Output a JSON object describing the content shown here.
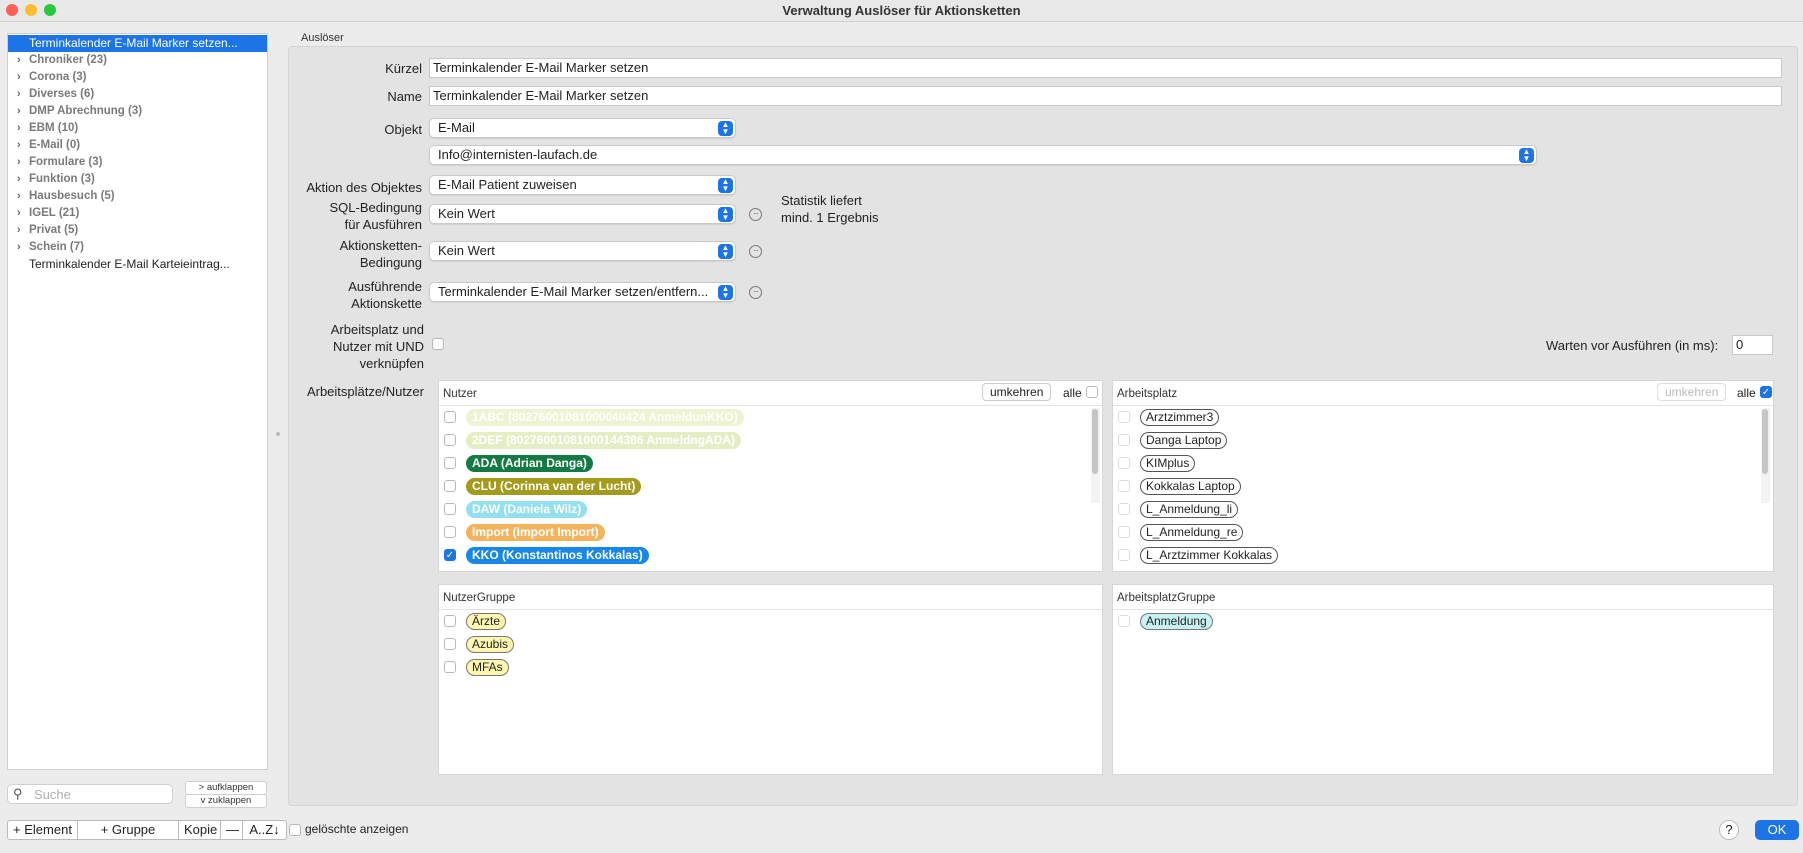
{
  "window": {
    "title": "Verwaltung Auslöser für Aktionsketten"
  },
  "sidebar": {
    "items": [
      {
        "label": "Terminkalender E-Mail Marker setzen...",
        "type": "selected"
      },
      {
        "label": "Chroniker (23)",
        "type": "group"
      },
      {
        "label": "Corona (3)",
        "type": "group"
      },
      {
        "label": "Diverses (6)",
        "type": "group"
      },
      {
        "label": "DMP Abrechnung (3)",
        "type": "group"
      },
      {
        "label": "EBM (10)",
        "type": "group"
      },
      {
        "label": "E-Mail (0)",
        "type": "group"
      },
      {
        "label": "Formulare (3)",
        "type": "group"
      },
      {
        "label": "Funktion (3)",
        "type": "group"
      },
      {
        "label": "Hausbesuch (5)",
        "type": "group"
      },
      {
        "label": "IGEL (21)",
        "type": "group"
      },
      {
        "label": "Privat (5)",
        "type": "group"
      },
      {
        "label": "Schein (7)",
        "type": "group"
      },
      {
        "label": "Terminkalender E-Mail Karteieintrag...",
        "type": "item"
      }
    ],
    "search_placeholder": "Suche",
    "expand_label": "> aufklappen",
    "collapse_label": "v  zuklappen"
  },
  "toolbar": {
    "add_element": "+ Element",
    "add_group": "+ Gruppe",
    "copy": "Kopie",
    "remove": "—",
    "sort": "A..Z↓"
  },
  "footer": {
    "show_deleted": "gelöschte anzeigen",
    "help": "?",
    "ok": "OK"
  },
  "form": {
    "section_title": "Auslöser",
    "kuerzel_label": "Kürzel",
    "kuerzel_value": "Terminkalender E-Mail Marker setzen",
    "name_label": "Name",
    "name_value": "Terminkalender E-Mail Marker setzen",
    "objekt_label": "Objekt",
    "objekt_value": "E-Mail",
    "email_value": "Info@internisten-laufach.de",
    "aktion_label": "Aktion des Objektes",
    "aktion_value": "E-Mail Patient zuweisen",
    "sql_label_1": "SQL-Bedingung",
    "sql_label_2": "für Ausführen",
    "sql_value": "Kein Wert",
    "statistik_1": "Statistik liefert",
    "statistik_2": "mind. 1 Ergebnis",
    "aktk_label_1": "Aktionsketten-",
    "aktk_label_2": "Bedingung",
    "aktk_value": "Kein Wert",
    "ausf_label_1": "Ausführende",
    "ausf_label_2": "Aktionskette",
    "ausf_value": "Terminkalender E-Mail Marker setzen/entfern...",
    "arb_label_1": "Arbeitsplatz und",
    "arb_label_2": "Nutzer mit UND",
    "arb_label_3": "verknüpfen",
    "warten_label": "Warten vor Ausführen (in ms):",
    "warten_value": "0",
    "ap_nutzer_label": "Arbeitsplätze/Nutzer"
  },
  "nutzer_panel": {
    "title": "Nutzer",
    "reverse": "umkehren",
    "all": "alle",
    "items": [
      {
        "label": "1ABC (80276001081000040424 AnmeldunKKO)",
        "bg": "#eef3d2",
        "fg": "#ffffff",
        "checked": false
      },
      {
        "label": "2DEF (80276001081000144386 AnmeldngADA)",
        "bg": "#e4edc4",
        "fg": "#ffffff",
        "checked": false
      },
      {
        "label": "ADA (Adrian Danga)",
        "bg": "#137a43",
        "fg": "#ffffff",
        "checked": false
      },
      {
        "label": "CLU (Corinna van der Lucht)",
        "bg": "#a49a1d",
        "fg": "#ffffff",
        "checked": false
      },
      {
        "label": "DAW (Daniela Wilz)",
        "bg": "#93e0ee",
        "fg": "#ffffff",
        "checked": false
      },
      {
        "label": "Import (Import Import)",
        "bg": "#f4b45e",
        "fg": "#ffffff",
        "checked": false
      },
      {
        "label": "KKO (Konstantinos Kokkalas)",
        "bg": "#1887e8",
        "fg": "#ffffff",
        "checked": true
      }
    ]
  },
  "arbeitsplatz_panel": {
    "title": "Arbeitsplatz",
    "reverse": "umkehren",
    "all": "alle",
    "items": [
      "Arztzimmer3",
      "Danga Laptop",
      "KIMplus",
      "Kokkalas Laptop",
      "L_Anmeldung_li",
      "L_Anmeldung_re",
      "L_Arztzimmer Kokkalas"
    ]
  },
  "nutzergruppe_panel": {
    "title": "NutzerGruppe",
    "items": [
      "Ärzte",
      "Azubis",
      "MFAs"
    ],
    "tag_bg": "#fdf6b0"
  },
  "arbeitsplatzgruppe_panel": {
    "title": "ArbeitsplatzGruppe",
    "items": [
      "Anmeldung"
    ],
    "tag_bg": "#c8f2f2"
  },
  "colors": {
    "accent": "#1c74e6"
  }
}
